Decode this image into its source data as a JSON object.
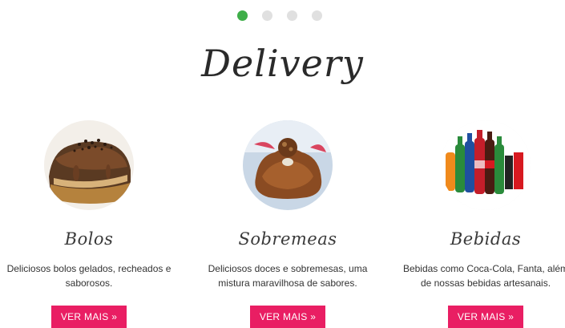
{
  "carousel": {
    "dots": [
      {
        "active": true
      },
      {
        "active": false
      },
      {
        "active": false
      },
      {
        "active": false
      }
    ]
  },
  "section": {
    "title": "Delivery"
  },
  "items": [
    {
      "name": "Bolos",
      "description": "Deliciosos bolos gelados, recheados e saborosos.",
      "button": "VER MAIS »",
      "image_icon": "cake-image"
    },
    {
      "name": "Sobremeas",
      "description": "Deliciosos doces e sobremesas, uma mistura maravilhosa de sabores.",
      "button": "VER MAIS »",
      "image_icon": "dessert-image"
    },
    {
      "name": "Bebidas",
      "description": "Bebidas como Coca-Cola, Fanta, além de nossas bebidas artesanais.",
      "button": "VER MAIS »",
      "image_icon": "drinks-image"
    }
  ],
  "colors": {
    "accent_button": "#e91e63",
    "active_dot": "#3fae49",
    "inactive_dot": "#e0e0e0"
  }
}
